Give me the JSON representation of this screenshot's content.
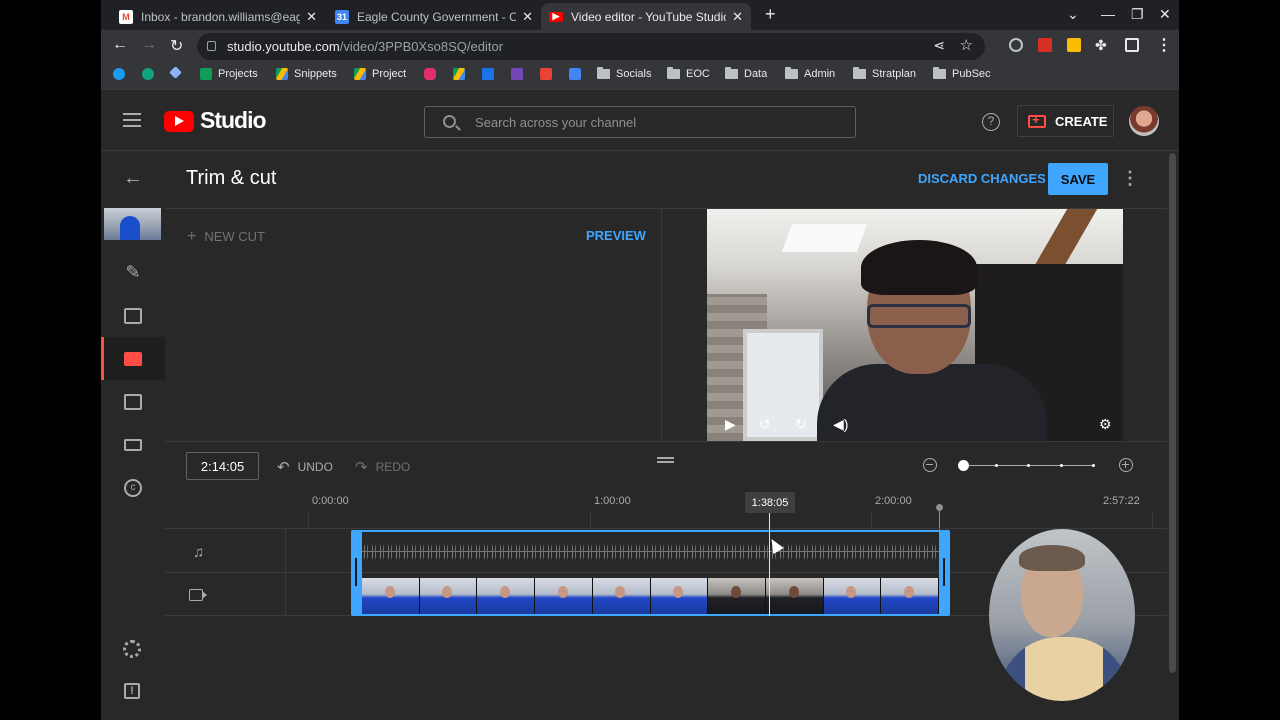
{
  "browser": {
    "tabs": [
      {
        "title": "Inbox - brandon.williams@eagle",
        "favicon": "gmail-icon"
      },
      {
        "title": "Eagle County Government - Cale",
        "favicon": "calendar-icon"
      },
      {
        "title": "Video editor - YouTube Studio",
        "favicon": "youtube-icon"
      }
    ],
    "new_tab": "+",
    "url_host": "studio.youtube.com",
    "url_path": "/video/3PPB0Xso8SQ/editor",
    "bookmarks": [
      "Projects",
      "Snippets",
      "Project",
      "Socials",
      "EOC",
      "Data",
      "Admin",
      "Stratplan",
      "PubSec"
    ]
  },
  "studio": {
    "logo_text": "Studio",
    "search_placeholder": "Search across your channel",
    "help": "?",
    "create_label": "CREATE"
  },
  "editor": {
    "title": "Trim & cut",
    "discard_label": "DISCARD CHANGES",
    "save_label": "SAVE",
    "more": "⋮",
    "new_cut_label": "NEW CUT",
    "preview_label": "PREVIEW",
    "current_time": "2:14:05",
    "undo_label": "UNDO",
    "redo_label": "REDO",
    "ruler": [
      "0:00:00",
      "1:00:00",
      "2:00:00",
      "2:57:22"
    ],
    "playhead_time": "1:38:05"
  },
  "nav": {
    "feedback": "!"
  },
  "colors": {
    "accent": "#3ea6ff",
    "brand": "#ff0000",
    "background": "#282828"
  }
}
